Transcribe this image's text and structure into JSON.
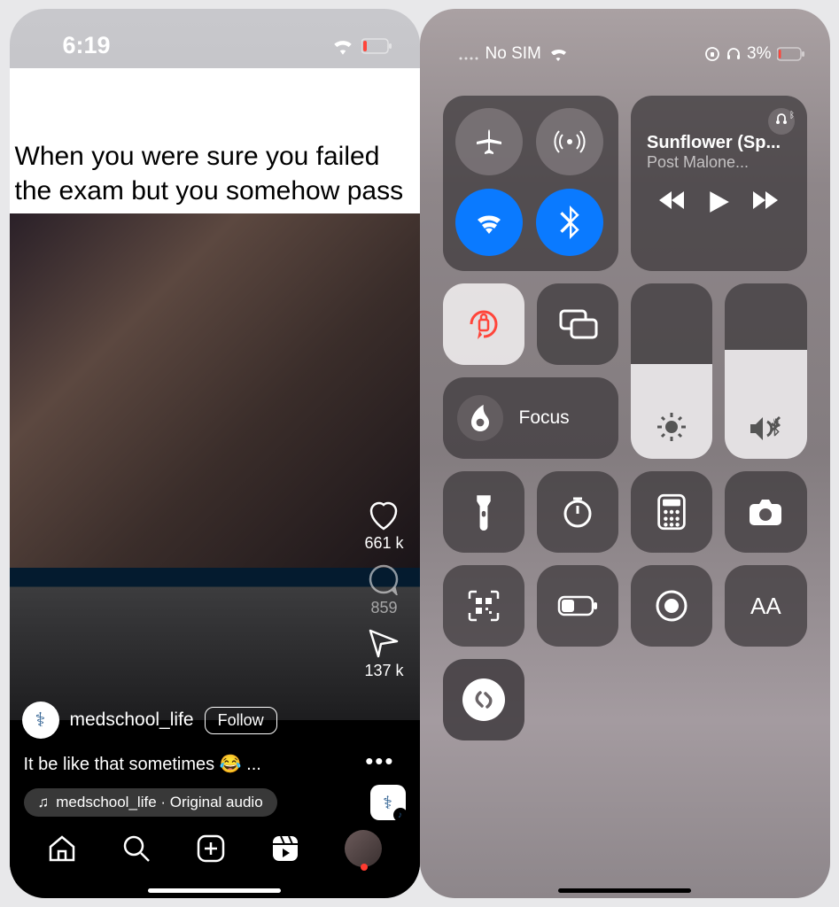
{
  "left": {
    "status": {
      "time": "6:19"
    },
    "meme_text": "When you were sure you failed the exam but you somehow pass",
    "actions": {
      "likes": "661 k",
      "comments": "859",
      "shares": "137 k"
    },
    "user": {
      "name": "medschool_life",
      "follow": "Follow"
    },
    "caption": "It be like that sometimes 😂 ...",
    "audio": "medschool_life · Original audio"
  },
  "right": {
    "status": {
      "carrier": "No SIM",
      "battery": "3%"
    },
    "music": {
      "title": "Sunflower (Sp...",
      "artist": "Post Malone..."
    },
    "focus_label": "Focus",
    "sliders": {
      "brightness_pct": 54,
      "volume_pct": 62
    },
    "text_size": "AA"
  }
}
